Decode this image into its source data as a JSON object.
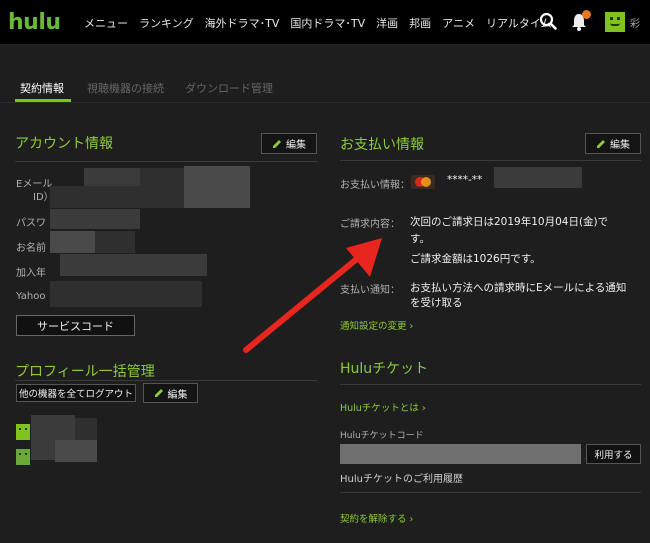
{
  "header": {
    "logo": "hulu",
    "nav": [
      "メニュー",
      "ランキング",
      "海外ドラマ･TV",
      "国内ドラマ･TV",
      "洋画",
      "邦画",
      "アニメ",
      "リアルタイム"
    ]
  },
  "tabs": [
    {
      "label": "契約情報",
      "active": true
    },
    {
      "label": "視聴機器の接続",
      "active": false
    },
    {
      "label": "ダウンロード管理",
      "active": false
    }
  ],
  "account": {
    "title": "アカウント情報",
    "edit": "編集",
    "email_label_1": "Eメール",
    "email_label_2": "ID）：",
    "password_label": "パスワ",
    "name_label": "お名前",
    "joined_label": "加入年",
    "yahoo_label": "Yahoo",
    "service_code_button": "サービスコード"
  },
  "profile": {
    "title": "プロフィール一括管理",
    "logout_all_button": "他の機器を全てログアウト",
    "edit": "編集"
  },
  "payment": {
    "title": "お支払い情報",
    "edit": "編集",
    "info_label": "お支払い情報：",
    "card_mask": "****-**",
    "billing_label": "ご請求内容：",
    "billing_line1": "次回のご請求日は2019年10月04日(金)で",
    "billing_line2": "す。",
    "billing_line3": "ご請求金額は1026円です。",
    "notice_label": "支払い通知：",
    "notice_line1": "お支払い方法への請求時にEメールによる通知",
    "notice_line2": "を受け取る",
    "notice_settings_link": "通知設定の変更 ›"
  },
  "ticket": {
    "title": "Huluチケット",
    "about_link": "Huluチケットとは ›",
    "code_label": "Huluチケットコード",
    "code_value": "",
    "use_button": "利用する",
    "history": "Huluチケットのご利用履歴",
    "cancel_link": "契約を解除する ›"
  },
  "colors": {
    "accent": "#8ccc3a",
    "arrow": "#e8251f",
    "topbar": "#000000",
    "background": "#1e1e1e"
  }
}
